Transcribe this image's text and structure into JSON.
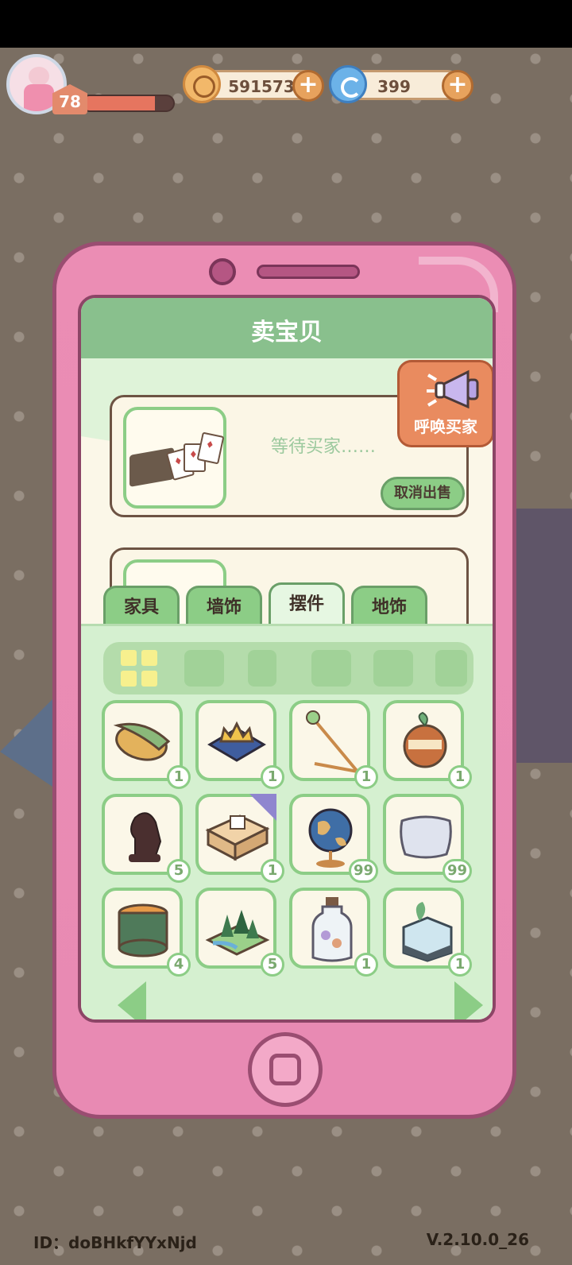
{
  "hud": {
    "level": "78",
    "xp_progress": 0.8,
    "coins": "591573",
    "gems": "399"
  },
  "screen": {
    "title": "卖宝贝",
    "sale_status": "等待买家……",
    "cancel_label": "取消出售",
    "summon_label": "呼唤买家"
  },
  "tabs": [
    {
      "label": "家具"
    },
    {
      "label": "墙饰"
    },
    {
      "label": "摆件"
    },
    {
      "label": "地饰"
    }
  ],
  "category_icons": [
    "grid-icon",
    "pot-icon",
    "cup-icon",
    "lamp-icon",
    "pillow-icon",
    "vase-icon"
  ],
  "items": [
    {
      "icon": "corn-icon",
      "count": "1"
    },
    {
      "icon": "crown-cushion-icon",
      "count": "1"
    },
    {
      "icon": "staff-icon",
      "count": "1"
    },
    {
      "icon": "apple-jar-icon",
      "count": "1"
    },
    {
      "icon": "chess-knight-icon",
      "count": "5"
    },
    {
      "icon": "tissue-box-icon",
      "count": "1"
    },
    {
      "icon": "globe-icon",
      "count": "99"
    },
    {
      "icon": "pillow-icon",
      "count": "99"
    },
    {
      "icon": "jar-icon",
      "count": "4"
    },
    {
      "icon": "forest-tile-icon",
      "count": "5"
    },
    {
      "icon": "bottle-icon",
      "count": "1"
    },
    {
      "icon": "terrarium-icon",
      "count": "1"
    }
  ],
  "footer": {
    "id": "ID：doBHkfYYxNjd",
    "version": "V.2.10.0_26"
  }
}
